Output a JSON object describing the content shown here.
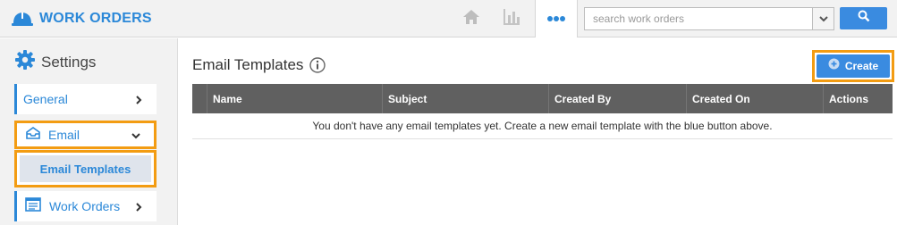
{
  "app": {
    "title": "WORK ORDERS",
    "brand_color": "#2b88d8",
    "brand_icon": "helmet-icon"
  },
  "topnav": {
    "icons": [
      "home-icon",
      "bar-chart-icon",
      "more-icon"
    ],
    "search": {
      "placeholder": "search work orders",
      "value": "",
      "button_icon": "search-icon"
    }
  },
  "sidebar": {
    "title": "Settings",
    "title_icon": "gear-icon",
    "items": [
      {
        "label": "General",
        "icon": "",
        "state": "collapsed"
      },
      {
        "label": "Email",
        "icon": "inbox-icon",
        "state": "expanded",
        "highlighted": true
      },
      {
        "label": "Work Orders",
        "icon": "list-icon",
        "state": "collapsed"
      }
    ],
    "subitems": [
      {
        "label": "Email Templates",
        "selected": true,
        "highlighted": true
      }
    ]
  },
  "main": {
    "title": "Email Templates",
    "create_label": "Create",
    "table": {
      "columns": [
        "Name",
        "Subject",
        "Created By",
        "Created On",
        "Actions"
      ],
      "rows": [],
      "empty_message": "You don't have any email templates yet. Create a new email template with the blue button above."
    }
  },
  "colors": {
    "accent": "#3a8be0",
    "highlight": "#f39c12",
    "table_header": "#606060"
  }
}
